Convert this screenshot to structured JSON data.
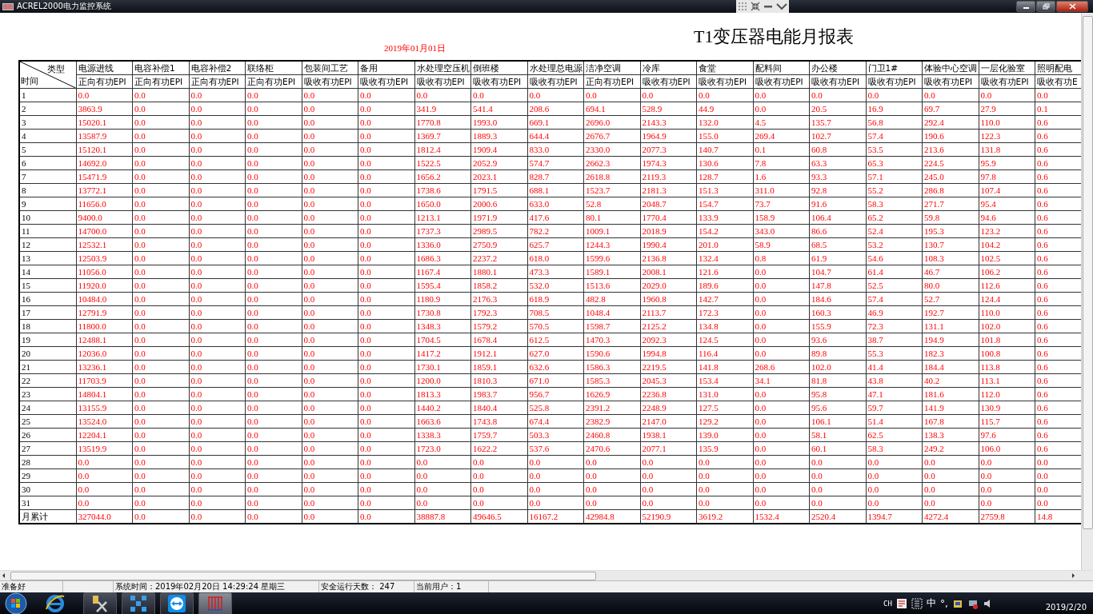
{
  "window": {
    "title": "ACREL2000电力监控系统"
  },
  "report": {
    "date": "2019年01月01日",
    "title": "T1变压器电能月报表",
    "corner": {
      "top": "类型",
      "bottom": "时间"
    },
    "columns": [
      {
        "name": "电源进线",
        "measure": "正向有功EPI"
      },
      {
        "name": "电容补偿1",
        "measure": "正向有功EPI"
      },
      {
        "name": "电容补偿2",
        "measure": "正向有功EPI"
      },
      {
        "name": "联络柜",
        "measure": "正向有功EPI"
      },
      {
        "name": "包装间工艺",
        "measure": "吸收有功EPI"
      },
      {
        "name": "备用",
        "measure": "吸收有功EPI"
      },
      {
        "name": "水处理空压机",
        "measure": "吸收有功EPI"
      },
      {
        "name": "倒班楼",
        "measure": "吸收有功EPI"
      },
      {
        "name": "水处理总电源",
        "measure": "吸收有功EPI"
      },
      {
        "name": "洁净空调",
        "measure": "正向有功EPI"
      },
      {
        "name": "冷库",
        "measure": "吸收有功EPI"
      },
      {
        "name": "食堂",
        "measure": "吸收有功EPI"
      },
      {
        "name": "配料间",
        "measure": "吸收有功EPI"
      },
      {
        "name": "办公楼",
        "measure": "吸收有功EPI"
      },
      {
        "name": "门卫1#",
        "measure": "吸收有功EPI"
      },
      {
        "name": "体验中心空调",
        "measure": "吸收有功EPI"
      },
      {
        "name": "一层化验室",
        "measure": "吸收有功EPI"
      },
      {
        "name": "照明配电",
        "measure": "吸收有功E"
      }
    ],
    "rows": [
      {
        "label": "1",
        "values": [
          "0.0",
          "0.0",
          "0.0",
          "0.0",
          "0.0",
          "0.0",
          "0.0",
          "0.0",
          "0.0",
          "0.0",
          "0.0",
          "0.0",
          "0.0",
          "0.0",
          "0.0",
          "0.0",
          "0.0",
          "0.0"
        ]
      },
      {
        "label": "2",
        "values": [
          "3863.9",
          "0.0",
          "0.0",
          "0.0",
          "0.0",
          "0.0",
          "341.9",
          "541.4",
          "208.6",
          "694.1",
          "528.9",
          "44.9",
          "0.0",
          "20.5",
          "16.9",
          "69.7",
          "27.9",
          "0.1"
        ]
      },
      {
        "label": "3",
        "values": [
          "15020.1",
          "0.0",
          "0.0",
          "0.0",
          "0.0",
          "0.0",
          "1770.8",
          "1993.0",
          "669.1",
          "2696.0",
          "2143.3",
          "132.0",
          "4.5",
          "135.7",
          "56.8",
          "292.4",
          "110.0",
          "0.6"
        ]
      },
      {
        "label": "4",
        "values": [
          "13587.9",
          "0.0",
          "0.0",
          "0.0",
          "0.0",
          "0.0",
          "1369.7",
          "1889.3",
          "644.4",
          "2676.7",
          "1964.9",
          "155.0",
          "269.4",
          "102.7",
          "57.4",
          "190.6",
          "122.3",
          "0.6"
        ]
      },
      {
        "label": "5",
        "values": [
          "15120.1",
          "0.0",
          "0.0",
          "0.0",
          "0.0",
          "0.0",
          "1812.4",
          "1909.4",
          "833.0",
          "2330.0",
          "2077.3",
          "140.7",
          "0.1",
          "60.8",
          "53.5",
          "213.6",
          "131.8",
          "0.6"
        ]
      },
      {
        "label": "6",
        "values": [
          "14692.0",
          "0.0",
          "0.0",
          "0.0",
          "0.0",
          "0.0",
          "1522.5",
          "2052.9",
          "574.7",
          "2662.3",
          "1974.3",
          "130.6",
          "7.8",
          "63.3",
          "65.3",
          "224.5",
          "95.9",
          "0.6"
        ]
      },
      {
        "label": "7",
        "values": [
          "15471.9",
          "0.0",
          "0.0",
          "0.0",
          "0.0",
          "0.0",
          "1656.2",
          "2023.1",
          "828.7",
          "2618.8",
          "2119.3",
          "128.7",
          "1.6",
          "93.3",
          "57.1",
          "245.0",
          "97.8",
          "0.6"
        ]
      },
      {
        "label": "8",
        "values": [
          "13772.1",
          "0.0",
          "0.0",
          "0.0",
          "0.0",
          "0.0",
          "1738.6",
          "1791.5",
          "688.1",
          "1523.7",
          "2181.3",
          "151.3",
          "311.0",
          "92.8",
          "55.2",
          "286.8",
          "107.4",
          "0.6"
        ]
      },
      {
        "label": "9",
        "values": [
          "11656.0",
          "0.0",
          "0.0",
          "0.0",
          "0.0",
          "0.0",
          "1650.0",
          "2000.6",
          "633.0",
          "52.8",
          "2048.7",
          "154.7",
          "73.7",
          "91.6",
          "58.3",
          "271.7",
          "95.4",
          "0.6"
        ]
      },
      {
        "label": "10",
        "values": [
          "9400.0",
          "0.0",
          "0.0",
          "0.0",
          "0.0",
          "0.0",
          "1213.1",
          "1971.9",
          "417.6",
          "80.1",
          "1770.4",
          "133.9",
          "158.9",
          "106.4",
          "65.2",
          "59.8",
          "94.6",
          "0.6"
        ]
      },
      {
        "label": "11",
        "values": [
          "14700.0",
          "0.0",
          "0.0",
          "0.0",
          "0.0",
          "0.0",
          "1737.3",
          "2989.5",
          "782.2",
          "1009.1",
          "2018.9",
          "154.2",
          "343.0",
          "86.6",
          "52.4",
          "195.3",
          "123.2",
          "0.6"
        ]
      },
      {
        "label": "12",
        "values": [
          "12532.1",
          "0.0",
          "0.0",
          "0.0",
          "0.0",
          "0.0",
          "1336.0",
          "2750.9",
          "625.7",
          "1244.3",
          "1990.4",
          "201.0",
          "58.9",
          "68.5",
          "53.2",
          "130.7",
          "104.2",
          "0.6"
        ]
      },
      {
        "label": "13",
        "values": [
          "12503.9",
          "0.0",
          "0.0",
          "0.0",
          "0.0",
          "0.0",
          "1686.3",
          "2237.2",
          "618.0",
          "1599.6",
          "2136.8",
          "132.4",
          "0.8",
          "61.9",
          "54.6",
          "108.3",
          "102.5",
          "0.6"
        ]
      },
      {
        "label": "14",
        "values": [
          "11056.0",
          "0.0",
          "0.0",
          "0.0",
          "0.0",
          "0.0",
          "1167.4",
          "1880.1",
          "473.3",
          "1589.1",
          "2008.1",
          "121.6",
          "0.0",
          "104.7",
          "61.4",
          "46.7",
          "106.2",
          "0.6"
        ]
      },
      {
        "label": "15",
        "values": [
          "11920.0",
          "0.0",
          "0.0",
          "0.0",
          "0.0",
          "0.0",
          "1595.4",
          "1858.2",
          "532.0",
          "1513.6",
          "2029.0",
          "189.6",
          "0.0",
          "147.8",
          "52.5",
          "80.0",
          "112.6",
          "0.6"
        ]
      },
      {
        "label": "16",
        "values": [
          "10484.0",
          "0.0",
          "0.0",
          "0.0",
          "0.0",
          "0.0",
          "1180.9",
          "2176.3",
          "618.9",
          "482.8",
          "1960.8",
          "142.7",
          "0.0",
          "184.6",
          "57.4",
          "52.7",
          "124.4",
          "0.6"
        ]
      },
      {
        "label": "17",
        "values": [
          "12791.9",
          "0.0",
          "0.0",
          "0.0",
          "0.0",
          "0.0",
          "1730.8",
          "1792.3",
          "708.5",
          "1048.4",
          "2113.7",
          "172.3",
          "0.0",
          "160.3",
          "46.9",
          "192.7",
          "110.0",
          "0.6"
        ]
      },
      {
        "label": "18",
        "values": [
          "11800.0",
          "0.0",
          "0.0",
          "0.0",
          "0.0",
          "0.0",
          "1348.3",
          "1579.2",
          "570.5",
          "1598.7",
          "2125.2",
          "134.8",
          "0.0",
          "155.9",
          "72.3",
          "131.1",
          "102.0",
          "0.6"
        ]
      },
      {
        "label": "19",
        "values": [
          "12488.1",
          "0.0",
          "0.0",
          "0.0",
          "0.0",
          "0.0",
          "1704.5",
          "1678.4",
          "612.5",
          "1470.3",
          "2092.3",
          "124.5",
          "0.0",
          "93.6",
          "38.7",
          "194.9",
          "101.8",
          "0.6"
        ]
      },
      {
        "label": "20",
        "values": [
          "12036.0",
          "0.0",
          "0.0",
          "0.0",
          "0.0",
          "0.0",
          "1417.2",
          "1912.1",
          "627.0",
          "1590.6",
          "1994.8",
          "116.4",
          "0.0",
          "89.8",
          "55.3",
          "182.3",
          "100.8",
          "0.6"
        ]
      },
      {
        "label": "21",
        "values": [
          "13236.1",
          "0.0",
          "0.0",
          "0.0",
          "0.0",
          "0.0",
          "1730.1",
          "1859.1",
          "632.6",
          "1586.3",
          "2219.5",
          "141.8",
          "268.6",
          "102.0",
          "41.4",
          "184.4",
          "113.8",
          "0.6"
        ]
      },
      {
        "label": "22",
        "values": [
          "11703.9",
          "0.0",
          "0.0",
          "0.0",
          "0.0",
          "0.0",
          "1200.0",
          "1810.3",
          "671.0",
          "1585.3",
          "2045.3",
          "153.4",
          "34.1",
          "81.8",
          "43.8",
          "40.2",
          "113.1",
          "0.6"
        ]
      },
      {
        "label": "23",
        "values": [
          "14804.1",
          "0.0",
          "0.0",
          "0.0",
          "0.0",
          "0.0",
          "1813.3",
          "1983.7",
          "956.7",
          "1626.9",
          "2236.8",
          "131.0",
          "0.0",
          "95.8",
          "47.1",
          "181.6",
          "112.0",
          "0.6"
        ]
      },
      {
        "label": "24",
        "values": [
          "13155.9",
          "0.0",
          "0.0",
          "0.0",
          "0.0",
          "0.0",
          "1440.2",
          "1840.4",
          "525.8",
          "2391.2",
          "2248.9",
          "127.5",
          "0.0",
          "95.6",
          "59.7",
          "141.9",
          "130.9",
          "0.6"
        ]
      },
      {
        "label": "25",
        "values": [
          "13524.0",
          "0.0",
          "0.0",
          "0.0",
          "0.0",
          "0.0",
          "1663.6",
          "1743.8",
          "674.4",
          "2382.9",
          "2147.0",
          "129.2",
          "0.0",
          "106.1",
          "51.4",
          "167.8",
          "115.7",
          "0.6"
        ]
      },
      {
        "label": "26",
        "values": [
          "12204.1",
          "0.0",
          "0.0",
          "0.0",
          "0.0",
          "0.0",
          "1338.3",
          "1759.7",
          "503.3",
          "2460.8",
          "1938.1",
          "139.0",
          "0.0",
          "58.1",
          "62.5",
          "138.3",
          "97.6",
          "0.6"
        ]
      },
      {
        "label": "27",
        "values": [
          "13519.9",
          "0.0",
          "0.0",
          "0.0",
          "0.0",
          "0.0",
          "1723.0",
          "1622.2",
          "537.6",
          "2470.6",
          "2077.1",
          "135.9",
          "0.0",
          "60.1",
          "58.3",
          "249.2",
          "106.0",
          "0.6"
        ]
      },
      {
        "label": "28",
        "values": [
          "0.0",
          "0.0",
          "0.0",
          "0.0",
          "0.0",
          "0.0",
          "0.0",
          "0.0",
          "0.0",
          "0.0",
          "0.0",
          "0.0",
          "0.0",
          "0.0",
          "0.0",
          "0.0",
          "0.0",
          "0.0"
        ]
      },
      {
        "label": "29",
        "values": [
          "0.0",
          "0.0",
          "0.0",
          "0.0",
          "0.0",
          "0.0",
          "0.0",
          "0.0",
          "0.0",
          "0.0",
          "0.0",
          "0.0",
          "0.0",
          "0.0",
          "0.0",
          "0.0",
          "0.0",
          "0.0"
        ]
      },
      {
        "label": "30",
        "values": [
          "0.0",
          "0.0",
          "0.0",
          "0.0",
          "0.0",
          "0.0",
          "0.0",
          "0.0",
          "0.0",
          "0.0",
          "0.0",
          "0.0",
          "0.0",
          "0.0",
          "0.0",
          "0.0",
          "0.0",
          "0.0"
        ]
      },
      {
        "label": "31",
        "values": [
          "0.0",
          "0.0",
          "0.0",
          "0.0",
          "0.0",
          "0.0",
          "0.0",
          "0.0",
          "0.0",
          "0.0",
          "0.0",
          "0.0",
          "0.0",
          "0.0",
          "0.0",
          "0.0",
          "0.0",
          "0.0"
        ]
      }
    ],
    "total": {
      "label": "月累计",
      "values": [
        "327044.0",
        "0.0",
        "0.0",
        "0.0",
        "0.0",
        "0.0",
        "38887.8",
        "49646.5",
        "16167.2",
        "42984.8",
        "52190.9",
        "3619.2",
        "1532.4",
        "2520.4",
        "1394.7",
        "4272.4",
        "2759.8",
        "14.8"
      ]
    }
  },
  "status_bar": {
    "ready": "准备好",
    "system_time": "系统时间：2019年02月20日  14:29:24   星期三",
    "safe_days": "安全运行天数：  247",
    "user": "当前用户：1"
  },
  "taskbar": {
    "tray": {
      "lang": "CH",
      "ime": "中",
      "punct": "°,",
      "date": "2019/2/20"
    }
  }
}
